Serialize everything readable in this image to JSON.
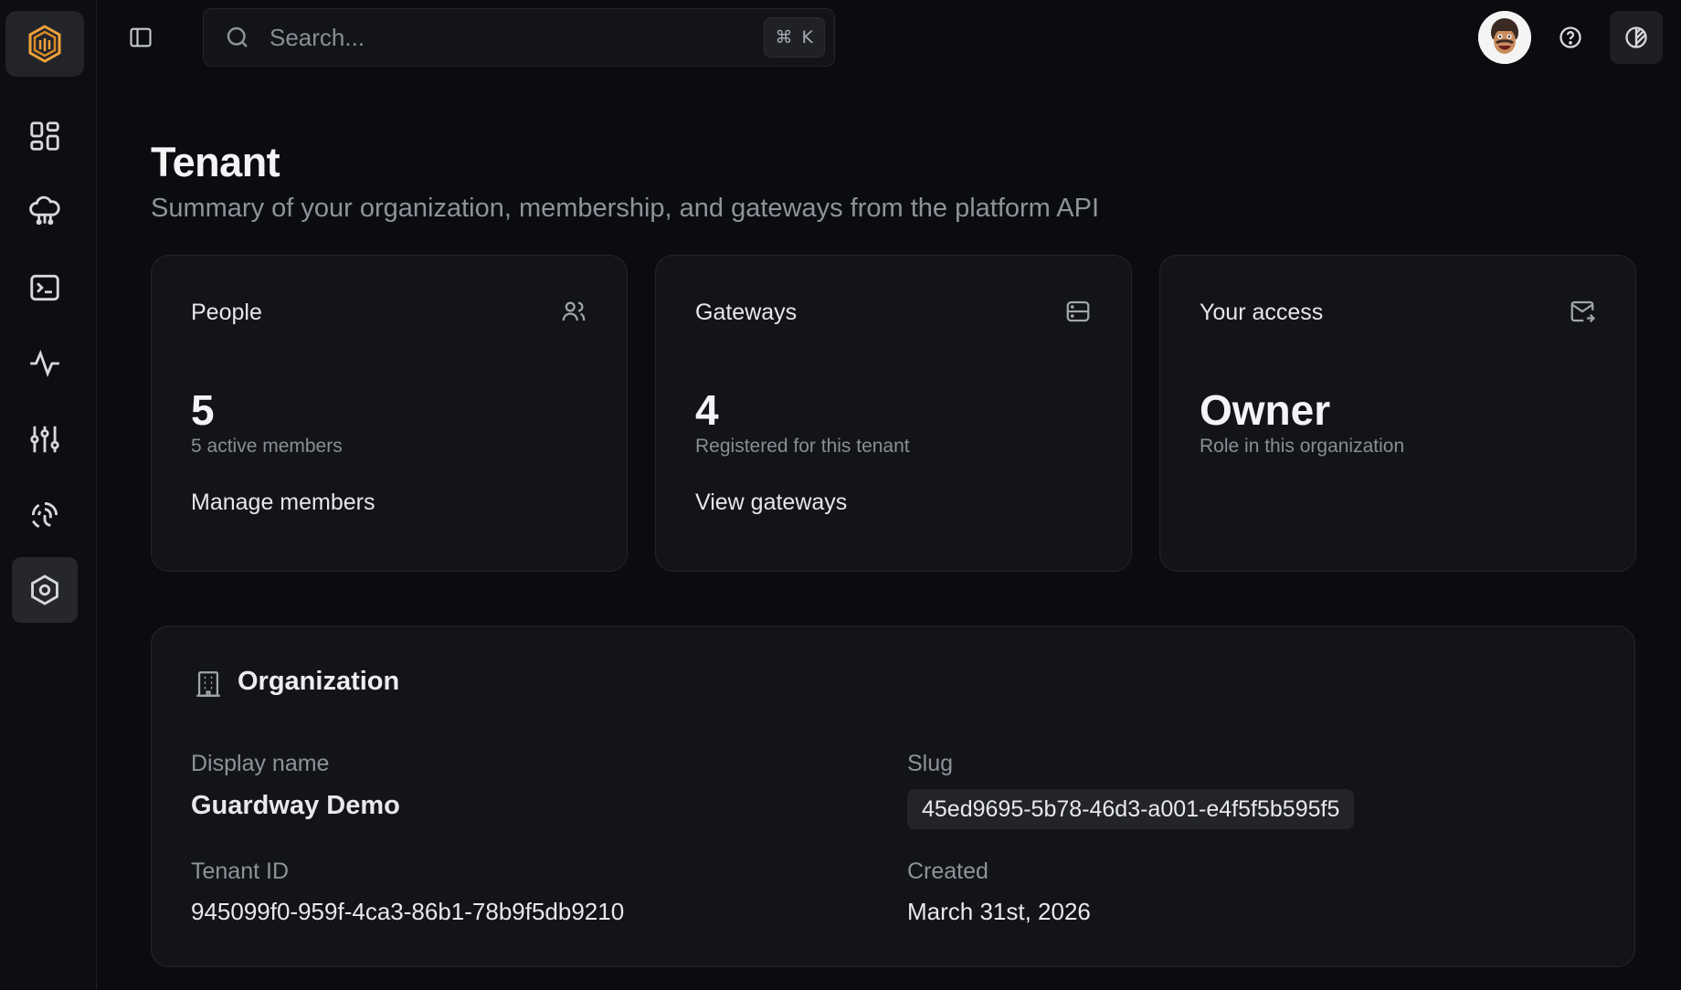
{
  "search": {
    "placeholder": "Search...",
    "shortcut_symbol": "⌘",
    "shortcut_key": "K"
  },
  "page": {
    "title": "Tenant",
    "subtitle": "Summary of your organization, membership, and gateways from the platform API"
  },
  "cards": {
    "people": {
      "title": "People",
      "value": "5",
      "caption": "5 active members",
      "link": "Manage members",
      "icon": "users-icon"
    },
    "gateways": {
      "title": "Gateways",
      "value": "4",
      "caption": "Registered for this tenant",
      "link": "View gateways",
      "icon": "server-icon"
    },
    "access": {
      "title": "Your access",
      "value": "Owner",
      "caption": "Role in this organization",
      "icon": "mail-icon"
    }
  },
  "organization": {
    "title": "Organization",
    "display_name_label": "Display name",
    "display_name": "Guardway Demo",
    "slug_label": "Slug",
    "slug": "45ed9695-5b78-46d3-a001-e4f5f5b595f5",
    "tenant_id_label": "Tenant ID",
    "tenant_id": "945099f0-959f-4ca3-86b1-78b9f5db9210",
    "created_label": "Created",
    "created": "March 31st, 2026"
  },
  "nav": [
    "dashboard-icon",
    "cloud-network-icon",
    "terminal-icon",
    "activity-icon",
    "sliders-icon",
    "fingerprint-icon",
    "settings-hex-icon"
  ],
  "colors": {
    "background": "#0b0c0f",
    "card": "#131418",
    "accent_logo": "#f0a23a"
  }
}
